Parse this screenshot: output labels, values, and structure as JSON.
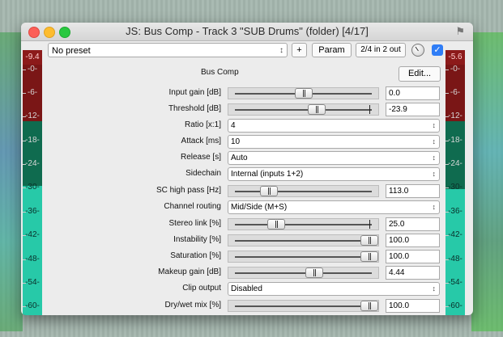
{
  "window": {
    "title": "JS: Bus Comp - Track 3 \"SUB Drums\" (folder) [4/17]",
    "pin_icon": "pin-icon"
  },
  "toolbar": {
    "preset": "No preset",
    "plus_label": "+",
    "param_label": "Param",
    "io_label": "2/4 in 2 out",
    "bypass_checked": true
  },
  "panel": {
    "title": "Bus Comp",
    "edit_label": "Edit..."
  },
  "meters": {
    "left_peak": "-9.4",
    "right_peak": "-5.6",
    "ticks": [
      "-0-",
      "-6-",
      "-12-",
      "-18-",
      "-24-",
      "-30-",
      "-36-",
      "-42-",
      "-48-",
      "-54-",
      "-60-"
    ]
  },
  "params": [
    {
      "label": "Input gain [dB]",
      "type": "slider",
      "value": "0.0",
      "position": 0.5
    },
    {
      "label": "Threshold [dB]",
      "type": "slider",
      "value": "-23.9",
      "position": 0.6,
      "mark": 0.98
    },
    {
      "label": "Ratio [x:1]",
      "type": "select",
      "value": "4"
    },
    {
      "label": "Attack [ms]",
      "type": "select",
      "value": "10"
    },
    {
      "label": "Release [s]",
      "type": "select",
      "value": "Auto"
    },
    {
      "label": "Sidechain",
      "type": "select",
      "value": "Internal (inputs 1+2)"
    },
    {
      "label": "SC high pass [Hz]",
      "type": "slider",
      "value": "113.0",
      "position": 0.25
    },
    {
      "label": "Channel routing",
      "type": "select",
      "value": "Mid/Side (M+S)"
    },
    {
      "label": "Stereo link [%]",
      "type": "slider",
      "value": "25.0",
      "position": 0.3,
      "mark": 0.98
    },
    {
      "label": "Instability [%]",
      "type": "slider",
      "value": "100.0",
      "position": 0.98
    },
    {
      "label": "Saturation [%]",
      "type": "slider",
      "value": "100.0",
      "position": 0.98
    },
    {
      "label": "Makeup gain [dB]",
      "type": "slider",
      "value": "4.44",
      "position": 0.58
    },
    {
      "label": "Clip output",
      "type": "select",
      "value": "Disabled"
    },
    {
      "label": "Dry/wet mix [%]",
      "type": "slider",
      "value": "100.0",
      "position": 0.98
    }
  ]
}
